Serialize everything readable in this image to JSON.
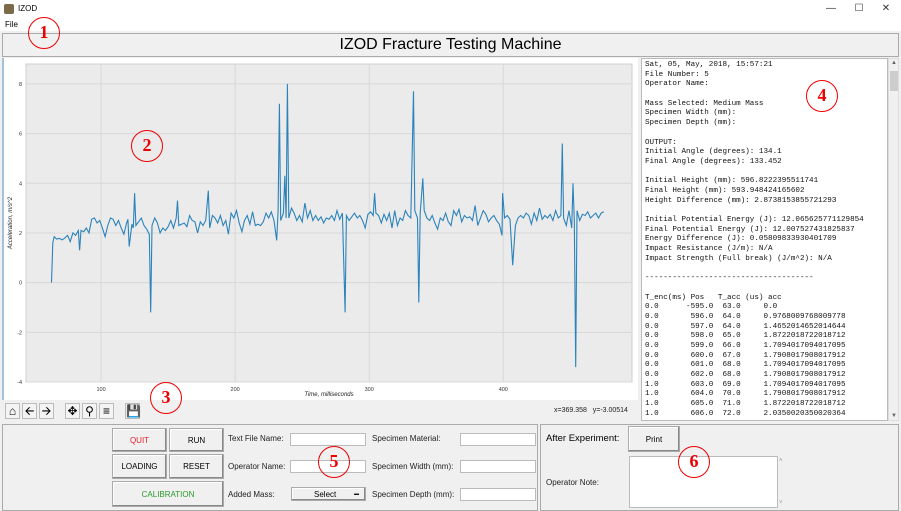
{
  "window": {
    "title": "IZOD",
    "minimize_icon": "minimize-icon",
    "maximize_icon": "maximize-icon",
    "close_icon": "close-icon"
  },
  "menu": {
    "items": [
      "File"
    ]
  },
  "header": {
    "title": "IZOD Fracture Testing Machine"
  },
  "toolbar": {
    "icons": [
      "home-icon",
      "back-icon",
      "forward-icon",
      "pan-icon",
      "zoom-icon",
      "configure-icon",
      "save-icon"
    ],
    "coords": "x=369.358   y=-3.00514"
  },
  "chart_data": {
    "type": "line",
    "title": "",
    "xlabel": "Time, milliseconds",
    "ylabel": "Acceleration, m/s^2",
    "xlim": [
      44,
      496
    ],
    "ylim": [
      -4,
      8.8
    ],
    "xticks": [
      100,
      200,
      300,
      400
    ],
    "yticks": [
      -4,
      -2,
      0,
      2,
      4,
      6,
      8
    ],
    "grid": true,
    "color": "#2b83ba",
    "points": [
      [
        63,
        0
      ],
      [
        64,
        1.6
      ],
      [
        65,
        1.85
      ],
      [
        67,
        1.75
      ],
      [
        69,
        1.78
      ],
      [
        71,
        1.72
      ],
      [
        73,
        1.8
      ],
      [
        75,
        1.9
      ],
      [
        77,
        1.65
      ],
      [
        79,
        2.0
      ],
      [
        81,
        1.9
      ],
      [
        83,
        2.1
      ],
      [
        84,
        1.3
      ],
      [
        85,
        2.1
      ],
      [
        87,
        2.05
      ],
      [
        89,
        2.2
      ],
      [
        91,
        2.0
      ],
      [
        93,
        2.55
      ],
      [
        95,
        2.6
      ],
      [
        97,
        2.4
      ],
      [
        99,
        2.5
      ],
      [
        101,
        2.2
      ],
      [
        103,
        1.85
      ],
      [
        105,
        2.3
      ],
      [
        107,
        2.6
      ],
      [
        109,
        2.55
      ],
      [
        111,
        2.3
      ],
      [
        113,
        2.5
      ],
      [
        115,
        2.2
      ],
      [
        117,
        1.95
      ],
      [
        119,
        2.4
      ],
      [
        120,
        2.55
      ],
      [
        121,
        1.45
      ],
      [
        123,
        2.35
      ],
      [
        124,
        2.2
      ],
      [
        125,
        3.6
      ],
      [
        126,
        2.3
      ],
      [
        128,
        2.45
      ],
      [
        130,
        2.6
      ],
      [
        132,
        2.3
      ],
      [
        134,
        2.15
      ],
      [
        136,
        1.95
      ],
      [
        137,
        -1.2
      ],
      [
        138,
        2.3
      ],
      [
        140,
        2.6
      ],
      [
        142,
        2.4
      ],
      [
        144,
        2.0
      ],
      [
        146,
        2.2
      ],
      [
        148,
        2.1
      ],
      [
        150,
        2.25
      ],
      [
        152,
        2.5
      ],
      [
        154,
        2.2
      ],
      [
        156,
        2.6
      ],
      [
        157,
        3.3
      ],
      [
        158,
        2.3
      ],
      [
        160,
        2.35
      ],
      [
        162,
        2.4
      ],
      [
        164,
        2.25
      ],
      [
        166,
        2.7
      ],
      [
        168,
        2.5
      ],
      [
        170,
        2.45
      ],
      [
        172,
        2.0
      ],
      [
        174,
        2.45
      ],
      [
        176,
        2.3
      ],
      [
        178,
        2.5
      ],
      [
        180,
        3.7
      ],
      [
        181,
        2.2
      ],
      [
        183,
        2.7
      ],
      [
        185,
        2.6
      ],
      [
        187,
        2.4
      ],
      [
        189,
        2.7
      ],
      [
        191,
        2.3
      ],
      [
        193,
        2.5
      ],
      [
        195,
        1.95
      ],
      [
        197,
        2.8
      ],
      [
        199,
        2.6
      ],
      [
        201,
        2.9
      ],
      [
        203,
        2.4
      ],
      [
        205,
        2.05
      ],
      [
        207,
        2.5
      ],
      [
        209,
        2.7
      ],
      [
        211,
        2.35
      ],
      [
        213,
        2.85
      ],
      [
        215,
        2.3
      ],
      [
        217,
        2.35
      ],
      [
        219,
        2.3
      ],
      [
        221,
        2.45
      ],
      [
        223,
        2.8
      ],
      [
        225,
        2.6
      ],
      [
        227,
        2.85
      ],
      [
        229,
        2.5
      ],
      [
        231,
        1.7
      ],
      [
        232,
        2.9
      ],
      [
        233,
        7.2
      ],
      [
        234,
        2.5
      ],
      [
        236,
        2.8
      ],
      [
        237,
        4.3
      ],
      [
        238,
        2.6
      ],
      [
        239,
        8.0
      ],
      [
        240,
        2.6
      ],
      [
        242,
        3.0
      ],
      [
        244,
        2.8
      ],
      [
        246,
        2.5
      ],
      [
        248,
        2.7
      ],
      [
        250,
        2.45
      ],
      [
        252,
        3.2
      ],
      [
        254,
        2.6
      ],
      [
        256,
        2.9
      ],
      [
        258,
        2.5
      ],
      [
        260,
        2.7
      ],
      [
        262,
        2.5
      ],
      [
        264,
        2.65
      ],
      [
        266,
        2.4
      ],
      [
        268,
        2.6
      ],
      [
        270,
        2.55
      ],
      [
        272,
        2.7
      ],
      [
        274,
        2.5
      ],
      [
        276,
        2.9
      ],
      [
        278,
        2.55
      ],
      [
        280,
        2.8
      ],
      [
        282,
        -1.2
      ],
      [
        283,
        2.7
      ],
      [
        285,
        2.5
      ],
      [
        287,
        2.65
      ],
      [
        289,
        2.8
      ],
      [
        291,
        2.6
      ],
      [
        293,
        2.7
      ],
      [
        295,
        2.5
      ],
      [
        297,
        2.2
      ],
      [
        299,
        2.75
      ],
      [
        301,
        2.85
      ],
      [
        303,
        2.7
      ],
      [
        304,
        3.6
      ],
      [
        305,
        2.8
      ],
      [
        307,
        2.7
      ],
      [
        309,
        2.4
      ],
      [
        311,
        2.75
      ],
      [
        313,
        2.5
      ],
      [
        315,
        2.8
      ],
      [
        317,
        2.2
      ],
      [
        319,
        2.9
      ],
      [
        321,
        2.3
      ],
      [
        323,
        2.6
      ],
      [
        325,
        2.5
      ],
      [
        327,
        2.9
      ],
      [
        329,
        2.7
      ],
      [
        331,
        2.6
      ],
      [
        333,
        7.7
      ],
      [
        334,
        2.9
      ],
      [
        336,
        2.6
      ],
      [
        337,
        -0.8
      ],
      [
        338,
        2.8
      ],
      [
        340,
        4.2
      ],
      [
        341,
        2.9
      ],
      [
        343,
        2.6
      ],
      [
        345,
        2.5
      ],
      [
        347,
        2.7
      ],
      [
        349,
        2.4
      ],
      [
        351,
        2.15
      ],
      [
        353,
        2.6
      ],
      [
        355,
        2.5
      ],
      [
        357,
        2.8
      ],
      [
        359,
        2.45
      ],
      [
        361,
        2.3
      ],
      [
        363,
        2.9
      ],
      [
        365,
        2.7
      ],
      [
        367,
        2.95
      ],
      [
        369,
        2.45
      ],
      [
        371,
        2.7
      ],
      [
        373,
        2.6
      ],
      [
        375,
        2.65
      ],
      [
        377,
        2.5
      ],
      [
        379,
        3.1
      ],
      [
        381,
        2.3
      ],
      [
        383,
        2.6
      ],
      [
        385,
        2.9
      ],
      [
        387,
        2.75
      ],
      [
        389,
        2.45
      ],
      [
        391,
        2.6
      ],
      [
        393,
        2.7
      ],
      [
        395,
        2.5
      ],
      [
        397,
        2.35
      ],
      [
        399,
        1.9
      ],
      [
        399.5,
        3.6
      ],
      [
        401,
        2.6
      ],
      [
        403,
        2.7
      ],
      [
        405,
        2.55
      ],
      [
        407,
        0.7
      ],
      [
        409,
        2.3
      ],
      [
        411,
        2.6
      ],
      [
        413,
        2.7
      ],
      [
        415,
        2.6
      ],
      [
        417,
        2.8
      ],
      [
        419,
        2.7
      ],
      [
        421,
        2.35
      ],
      [
        423,
        2.8
      ],
      [
        425,
        2.5
      ],
      [
        427,
        3.0
      ],
      [
        429,
        2.55
      ],
      [
        431,
        2.7
      ],
      [
        433,
        2.6
      ],
      [
        435,
        2.75
      ],
      [
        437,
        2.5
      ],
      [
        439,
        2.9
      ],
      [
        441,
        2.6
      ],
      [
        443,
        2.7
      ],
      [
        444,
        5.6
      ],
      [
        445,
        2.6
      ],
      [
        447,
        2.3
      ],
      [
        449,
        2.9
      ],
      [
        451,
        2.2
      ],
      [
        452,
        4.0
      ],
      [
        453,
        2.5
      ],
      [
        454,
        -3.4
      ],
      [
        455,
        2.9
      ],
      [
        457,
        2.5
      ],
      [
        459,
        2.75
      ],
      [
        461,
        2.7
      ],
      [
        463,
        2.85
      ],
      [
        465,
        2.6
      ],
      [
        467,
        2.7
      ],
      [
        469,
        2.8
      ],
      [
        471,
        2.6
      ],
      [
        473,
        2.8
      ],
      [
        475,
        2.85
      ]
    ]
  },
  "output_text": [
    "Sat, 05, May, 2018, 15:57:21",
    "File Number: 5",
    "Operator Name:",
    "",
    "Mass Selected: Medium Mass",
    "Specimen Width (mm):",
    "Specimen Depth (mm):",
    "",
    "OUTPUT:",
    "Initial Angle (degrees): 134.1",
    "Final Angle (degrees): 133.452",
    "",
    "Initial Height (mm): 596.8222395511741",
    "Final Height (mm): 593.948424165602",
    "Height Difference (mm): 2.873815385572129З",
    "",
    "Initial Potential Energy (J): 12.065625771129854",
    "Final Potential Energy (J): 12.007527431825837",
    "Energy Difference (J): 0.05809833930401709",
    "Impact Resistance (J/m): N/A",
    "Impact Strength (Full break) (J/m^2): N/A",
    "",
    "-------------------------------------",
    "",
    "T_enc(ms) Pos   T_acc (us) acc",
    "0.0      -595.0  63.0     0.0",
    "0.0       596.0  64.0     0.9768009768009778",
    "0.0       597.0  64.0     1.4652014652014644",
    "0.0       598.0  65.0     1.8722018722018712",
    "0.0       599.0  66.0     1.7094017094017095",
    "0.0       600.0  67.0     1.7908017908017912",
    "0.0       601.0  68.0     1.7094017094017095",
    "0.0       602.0  68.0     1.7908017908017912",
    "1.0       603.0  69.0     1.7094017094017095",
    "1.0       604.0  70.0     1.7908017908017912",
    "1.0       605.0  71.0     1.8722018722018712",
    "1.0       606.0  72.0     2.0350020350020364"
  ],
  "controls": {
    "quit": "QUIT",
    "run": "RUN",
    "loading": "LOADING",
    "reset": "RESET",
    "calibration": "CALIBRATION",
    "text_file_name_label": "Text File Name:",
    "operator_name_label": "Operator Name:",
    "added_mass_label": "Added Mass:",
    "added_mass_value": "Select",
    "specimen_material_label": "Specimen Material:",
    "specimen_width_label": "Specimen Width (mm):",
    "specimen_depth_label": "Specimen Depth (mm):",
    "text_file_name_value": "",
    "operator_name_value": "",
    "specimen_material_value": "",
    "specimen_width_value": "",
    "specimen_depth_value": ""
  },
  "after": {
    "label": "After Experiment:",
    "print": "Print",
    "operator_note_label": "Operator Note:",
    "operator_note_value": ""
  },
  "colors": {
    "quit": "#e0202a",
    "calibration": "#2a9a2a",
    "line": "#2b83ba",
    "annotation": "#e00000"
  },
  "annotations": [
    "1",
    "2",
    "3",
    "4",
    "5",
    "6"
  ]
}
